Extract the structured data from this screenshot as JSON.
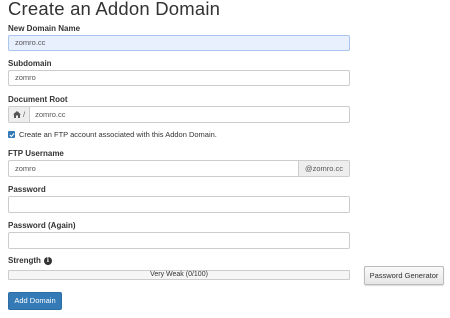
{
  "page": {
    "title": "Create an Addon Domain"
  },
  "form": {
    "new_domain": {
      "label": "New Domain Name",
      "value": "zomro.cc"
    },
    "subdomain": {
      "label": "Subdomain",
      "value": "zomro"
    },
    "document_root": {
      "label": "Document Root",
      "prefix": "/",
      "value": "zomro.cc"
    },
    "ftp_checkbox": {
      "checked": true,
      "label": "Create an FTP account associated with this Addon Domain."
    },
    "ftp_username": {
      "label": "FTP Username",
      "value": "zomro",
      "suffix": "@zomro.cc"
    },
    "password": {
      "label": "Password",
      "value": ""
    },
    "password_again": {
      "label": "Password (Again)",
      "value": ""
    },
    "strength": {
      "label": "Strength",
      "text": "Very Weak (0/100)",
      "score": 0
    }
  },
  "buttons": {
    "password_generator": "Password Generator",
    "add_domain": "Add Domain"
  },
  "colors": {
    "primary": "#337ab7",
    "focus_bg": "#e8f0fe",
    "strength_weak": "#d9534f"
  },
  "icons": {
    "home": "home-icon",
    "info": "info-icon",
    "check": "check-icon"
  }
}
